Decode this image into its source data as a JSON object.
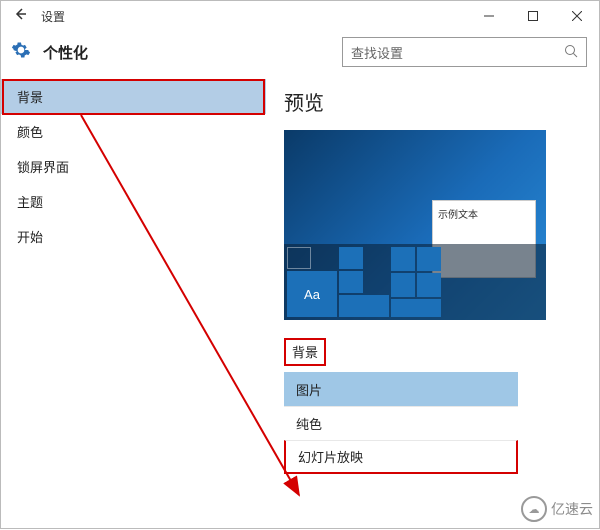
{
  "titlebar": {
    "title": "设置"
  },
  "header": {
    "section": "个性化",
    "search_placeholder": "查找设置"
  },
  "sidebar": {
    "items": [
      {
        "label": "背景"
      },
      {
        "label": "颜色"
      },
      {
        "label": "锁屏界面"
      },
      {
        "label": "主题"
      },
      {
        "label": "开始"
      }
    ]
  },
  "main": {
    "preview_title": "预览",
    "sample_text": "示例文本",
    "preview_tile_text": "Aa",
    "bg_label": "背景",
    "bg_options": [
      {
        "label": "图片"
      },
      {
        "label": "纯色"
      },
      {
        "label": "幻灯片放映"
      }
    ]
  },
  "watermark": {
    "text": "亿速云"
  }
}
